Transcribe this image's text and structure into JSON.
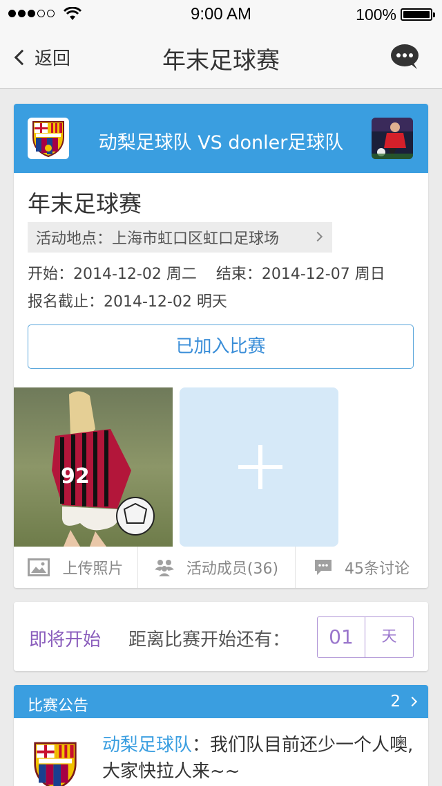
{
  "status_bar": {
    "time": "9:00 AM",
    "battery": "100%",
    "signal_dots": [
      true,
      true,
      true,
      false,
      false
    ]
  },
  "nav": {
    "back_label": "返回",
    "title": "年末足球赛",
    "chat_icon": "chat-bubble-icon"
  },
  "match": {
    "teams_title": "动梨足球队 VS donler足球队",
    "left_logo": "fcb-crest",
    "right_logo": "team-avatar"
  },
  "event": {
    "title": "年末足球赛",
    "location": "活动地点：上海市虹口区虹口足球场",
    "start": "开始：2014-12-02  周二",
    "end": "结束：2014-12-07  周日",
    "deadline": "报名截止：2014-12-02  明天",
    "joined_button": "已加入比赛"
  },
  "actions": {
    "upload": "上传照片",
    "members": "活动成员(36)",
    "discussion": "45条讨论"
  },
  "countdown": {
    "status": "即将开始",
    "label": "距离比赛开始还有：",
    "value": "01",
    "unit": "天"
  },
  "announcement": {
    "header": "比赛公告",
    "count": "2",
    "author": "动梨足球队",
    "text": "：我们队目前还少一个人噢,大家快拉人来~~"
  },
  "colors": {
    "accent_blue": "#3a9ee0",
    "purple": "#8a5dbc",
    "add_tile": "#d6e9f8"
  }
}
